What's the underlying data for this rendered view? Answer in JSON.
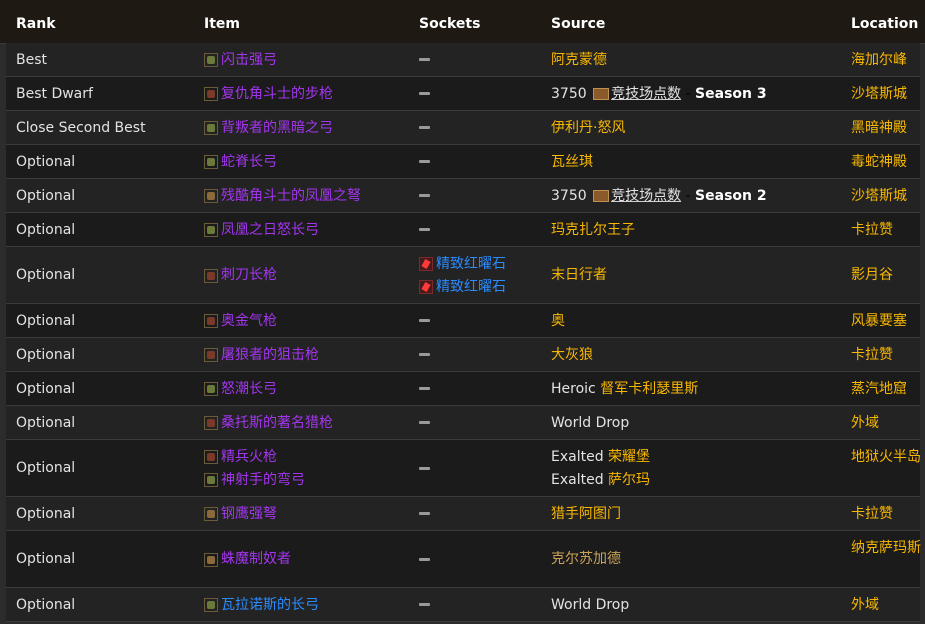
{
  "headers": {
    "rank": "Rank",
    "item": "Item",
    "sockets": "Sockets",
    "source": "Source",
    "location": "Location"
  },
  "rows": [
    {
      "rank": "Best",
      "items": [
        {
          "name": "闪击强弓",
          "quality": "epic",
          "icon": "bow-icon"
        }
      ],
      "sockets": [],
      "source": {
        "prefix": "",
        "text": "阿克蒙德"
      },
      "location": "海加尔峰"
    },
    {
      "rank": "Best Dwarf",
      "items": [
        {
          "name": "复仇角斗士的步枪",
          "quality": "epic",
          "icon": "gun-icon"
        }
      ],
      "sockets": [],
      "source": {
        "amount": "3750",
        "currency": "竞技场点数",
        "season": "Season 3"
      },
      "location": "沙塔斯城"
    },
    {
      "rank": "Close Second Best",
      "items": [
        {
          "name": "背叛者的黑暗之弓",
          "quality": "epic",
          "icon": "bow-icon"
        }
      ],
      "sockets": [],
      "source": {
        "prefix": "",
        "text": "伊利丹·怒风"
      },
      "location": "黑暗神殿"
    },
    {
      "rank": "Optional",
      "items": [
        {
          "name": "蛇脊长弓",
          "quality": "epic",
          "icon": "bow-icon"
        }
      ],
      "sockets": [],
      "source": {
        "prefix": "",
        "text": "瓦丝琪"
      },
      "location": "毒蛇神殿"
    },
    {
      "rank": "Optional",
      "items": [
        {
          "name": "残酷角斗士的凤凰之弩",
          "quality": "epic",
          "icon": "crossbow-icon"
        }
      ],
      "sockets": [],
      "source": {
        "amount": "3750",
        "currency": "竞技场点数",
        "season": "Season 2"
      },
      "location": "沙塔斯城"
    },
    {
      "rank": "Optional",
      "items": [
        {
          "name": "凤凰之日怒长弓",
          "quality": "epic",
          "icon": "bow-icon"
        }
      ],
      "sockets": [],
      "source": {
        "prefix": "",
        "text": "玛克扎尔王子"
      },
      "location": "卡拉赞"
    },
    {
      "rank": "Optional",
      "items": [
        {
          "name": "刺刀长枪",
          "quality": "epic",
          "icon": "gun-icon"
        }
      ],
      "sockets": [
        "精致红曜石",
        "精致红曜石"
      ],
      "source": {
        "prefix": "",
        "text": "末日行者"
      },
      "location": "影月谷"
    },
    {
      "rank": "Optional",
      "items": [
        {
          "name": "奥金气枪",
          "quality": "epic",
          "icon": "gun-icon"
        }
      ],
      "sockets": [],
      "source": {
        "prefix": "",
        "text": "奥"
      },
      "location": "风暴要塞"
    },
    {
      "rank": "Optional",
      "items": [
        {
          "name": "屠狼者的狙击枪",
          "quality": "epic",
          "icon": "gun-icon"
        }
      ],
      "sockets": [],
      "source": {
        "prefix": "",
        "text": "大灰狼"
      },
      "location": "卡拉赞"
    },
    {
      "rank": "Optional",
      "items": [
        {
          "name": "怒潮长弓",
          "quality": "epic",
          "icon": "bow-icon"
        }
      ],
      "sockets": [],
      "source": {
        "prefix": "Heroic",
        "text": "督军卡利瑟里斯"
      },
      "location": "蒸汽地窟"
    },
    {
      "rank": "Optional",
      "items": [
        {
          "name": "桑托斯的著名猎枪",
          "quality": "epic",
          "icon": "gun-icon"
        }
      ],
      "sockets": [],
      "source": {
        "prefix": "World Drop",
        "text": ""
      },
      "location": "外域"
    },
    {
      "rank": "Optional",
      "items": [
        {
          "name": "精兵火枪",
          "quality": "epic",
          "icon": "gun-icon"
        },
        {
          "name": "神射手的弯弓",
          "quality": "epic",
          "icon": "bow-icon"
        }
      ],
      "sockets": [],
      "source": {
        "lines": [
          {
            "prefix": "Exalted",
            "text": "荣耀堡"
          },
          {
            "prefix": "Exalted",
            "text": "萨尔玛"
          }
        ]
      },
      "location": "地狱火半岛"
    },
    {
      "rank": "Optional",
      "items": [
        {
          "name": "钢鹰强弩",
          "quality": "epic",
          "icon": "crossbow-icon"
        }
      ],
      "sockets": [],
      "source": {
        "prefix": "",
        "text": "猎手阿图门"
      },
      "location": "卡拉赞"
    },
    {
      "rank": "Optional",
      "items": [
        {
          "name": "蛛魔制奴者",
          "quality": "epic",
          "icon": "crossbow-icon"
        }
      ],
      "sockets": [],
      "source": {
        "prefix": "",
        "text": "克尔苏加德"
      },
      "location": "纳克萨玛斯"
    },
    {
      "rank": "Optional",
      "items": [
        {
          "name": "瓦拉诺斯的长弓",
          "quality": "rare",
          "icon": "bow-icon"
        }
      ],
      "sockets": [],
      "source": {
        "prefix": "World Drop",
        "text": ""
      },
      "location": "外域"
    }
  ],
  "colors": {
    "epic": "#a335ee",
    "rare": "#2a8bff",
    "gold": "#f8b700",
    "header_bg": "#1e1a13"
  }
}
